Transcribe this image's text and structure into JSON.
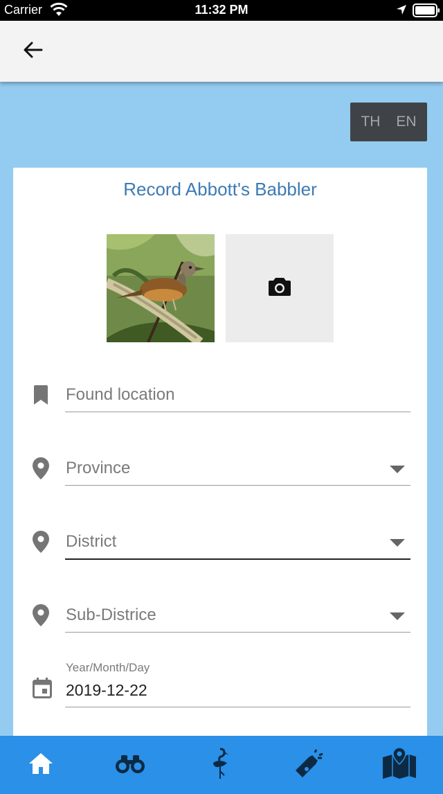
{
  "status_bar": {
    "carrier": "Carrier",
    "time": "11:32 PM"
  },
  "app_bar": {
    "back_icon": "arrow-left-icon"
  },
  "language": {
    "th": "TH",
    "en": "EN"
  },
  "card": {
    "title": "Record Abbott's Babbler",
    "photos": {
      "bird_photo": "bird-photo",
      "add_photo_icon": "camera-icon"
    },
    "fields": {
      "found_location": {
        "placeholder": "Found location",
        "icon": "bookmark-icon"
      },
      "province": {
        "placeholder": "Province",
        "icon": "location-pin-icon"
      },
      "district": {
        "placeholder": "District",
        "icon": "location-pin-icon"
      },
      "sub_district": {
        "placeholder": "Sub-Districe",
        "icon": "location-pin-icon"
      },
      "date": {
        "caption": "Year/Month/Day",
        "value": "2019-12-22",
        "icon": "calendar-icon"
      }
    }
  },
  "bottom_nav": {
    "items": [
      {
        "icon": "home-icon"
      },
      {
        "icon": "binoculars-icon"
      },
      {
        "icon": "flamingo-icon"
      },
      {
        "icon": "megaphone-icon"
      },
      {
        "icon": "map-icon"
      }
    ]
  },
  "colors": {
    "background": "#94cbf0",
    "title": "#3d7ab3",
    "nav": "#2a90e8",
    "lang_toggle": "#3f4347"
  }
}
